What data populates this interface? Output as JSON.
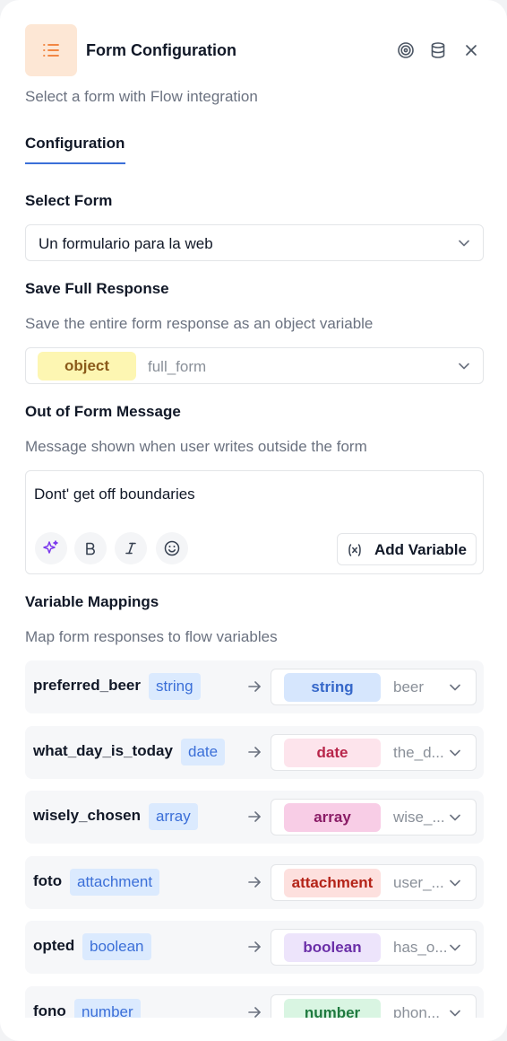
{
  "header": {
    "title": "Form Configuration",
    "subtitle": "Select a form with Flow integration",
    "icons": [
      "list-icon",
      "target-icon",
      "database-icon",
      "close-icon"
    ]
  },
  "tabs": [
    {
      "label": "Configuration",
      "active": true
    }
  ],
  "select_form": {
    "label": "Select Form",
    "value": "Un formulario para la web"
  },
  "save_full_response": {
    "label": "Save Full Response",
    "help": "Save the entire form response as an object variable",
    "type": "object",
    "variable": "full_form"
  },
  "out_of_form": {
    "label": "Out of Form Message",
    "help": "Message shown when user writes outside the form",
    "message": "Dont' get off boundaries",
    "toolbar": [
      "sparkle-icon",
      "bold-icon",
      "italic-icon",
      "emoji-icon"
    ],
    "add_variable_label": "Add Variable"
  },
  "mappings": {
    "label": "Variable Mappings",
    "help": "Map form responses to flow variables",
    "rows": [
      {
        "field": "preferred_beer",
        "field_type": "string",
        "var_type": "string",
        "variable": "beer"
      },
      {
        "field": "what_day_is_today",
        "field_type": "date",
        "var_type": "date",
        "variable": "the_d..."
      },
      {
        "field": "wisely_chosen",
        "field_type": "array",
        "var_type": "array",
        "variable": "wise_..."
      },
      {
        "field": "foto",
        "field_type": "attachment",
        "var_type": "attachment",
        "variable": "user_..."
      },
      {
        "field": "opted",
        "field_type": "boolean",
        "var_type": "boolean",
        "variable": "has_o..."
      },
      {
        "field": "fono",
        "field_type": "number",
        "var_type": "number",
        "variable": "phon..."
      }
    ]
  },
  "colors": {
    "accent": "#3b6fd8",
    "header_icon_bg": "#fde7d5",
    "header_icon": "#f07a2f",
    "chips": {
      "object": {
        "bg": "#fdf6b2",
        "fg": "#8a5a1a"
      },
      "string": {
        "bg": "#d6e6fd",
        "fg": "#3567c9"
      },
      "date": {
        "bg": "#fde4ec",
        "fg": "#b8254a"
      },
      "array": {
        "bg": "#f8cde6",
        "fg": "#8a1c66"
      },
      "attachment": {
        "bg": "#fde0de",
        "fg": "#b42318"
      },
      "boolean": {
        "bg": "#ede4fb",
        "fg": "#6b2fa8"
      },
      "number": {
        "bg": "#d9f5e2",
        "fg": "#1f7a3f"
      }
    }
  }
}
